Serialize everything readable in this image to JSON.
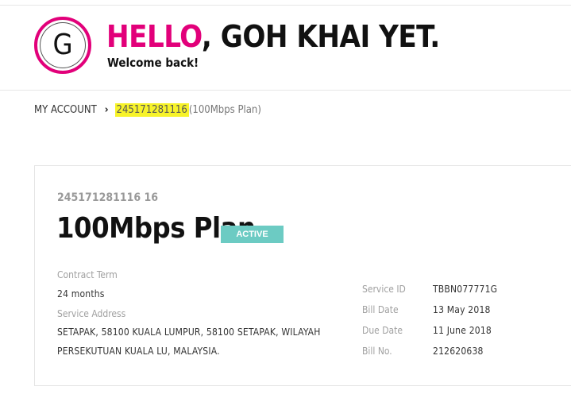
{
  "header": {
    "avatar_initial": "G",
    "greeting_hello": "HELLO",
    "greeting_name": ", GOH KHAI YET.",
    "welcome": "Welcome back!"
  },
  "breadcrumb": {
    "root": "MY ACCOUNT",
    "current_number": "245171281116",
    "current_plan": " (100Mbps Plan)"
  },
  "account": {
    "id": "245171281116 16",
    "plan_name": "100Mbps Plan",
    "status": "ACTIVE",
    "contract_term_label": "Contract Term",
    "contract_term_value": "24 months",
    "service_address_label": "Service Address",
    "service_address_line1": "SETAPAK, 58100 KUALA LUMPUR, 58100 SETAPAK, WILAYAH",
    "service_address_line2": "PERSEKUTUAN KUALA LU, MALAYSIA.",
    "details": [
      {
        "label": "Service ID",
        "value": "TBBN077771G"
      },
      {
        "label": "Bill Date",
        "value": "13 May 2018"
      },
      {
        "label": "Due Date",
        "value": "11 June 2018"
      },
      {
        "label": "Bill No.",
        "value": "212620638"
      }
    ]
  },
  "colors": {
    "brand_pink": "#e2007a",
    "status_teal": "#6ccbc3",
    "highlight_yellow": "#f7f32a"
  }
}
